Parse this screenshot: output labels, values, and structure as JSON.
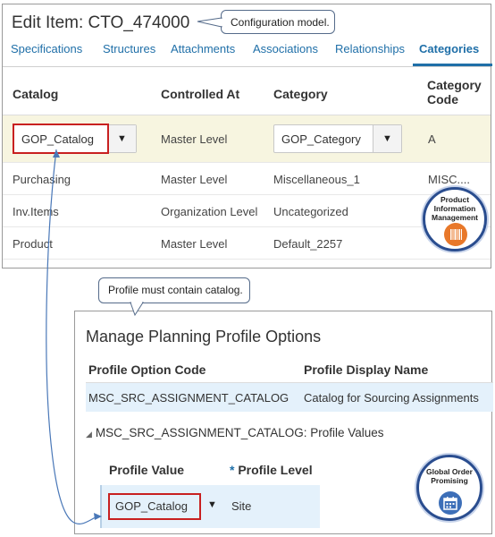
{
  "edit_item": {
    "title": "Edit Item: CTO_474000",
    "callout": "Configuration  model.",
    "tabs": [
      {
        "label": "Specifications"
      },
      {
        "label": "Structures"
      },
      {
        "label": "Attachments"
      },
      {
        "label": "Associations"
      },
      {
        "label": "Relationships"
      },
      {
        "label": "Categories",
        "active": true
      }
    ],
    "columns": {
      "catalog": "Catalog",
      "controlled_at": "Controlled At",
      "category": "Category",
      "category_code_line1": "Category",
      "category_code_line2": "Code"
    },
    "rows": [
      {
        "catalog": "GOP_Catalog",
        "controlled_at": "Master Level",
        "category": "GOP_Category",
        "code": "A"
      },
      {
        "catalog": "Purchasing",
        "controlled_at": "Master Level",
        "category": "Miscellaneous_1",
        "code": "MISC...."
      },
      {
        "catalog": "Inv.Items",
        "controlled_at": "Organization Level",
        "category": "Uncategorized",
        "code": ""
      },
      {
        "catalog": "Product",
        "controlled_at": "Master Level",
        "category": "Default_2257",
        "code": ""
      }
    ],
    "badge": {
      "line1": "Product",
      "line2": "Information",
      "line3": "Management",
      "icon": "barcode-icon",
      "icon_color": "#e8782a"
    }
  },
  "profile_callout": "Profile must contain catalog.",
  "planning_profile": {
    "title": "Manage Planning Profile Options",
    "columns": {
      "code": "Profile Option Code",
      "display": "Profile Display Name"
    },
    "row": {
      "code": "MSC_SRC_ASSIGNMENT_CATALOG",
      "display": "Catalog for Sourcing Assignments"
    },
    "values_heading": "MSC_SRC_ASSIGNMENT_CATALOG: Profile Values",
    "values_columns": {
      "value": "Profile Value",
      "required_mark": "*",
      "level": "Profile Level"
    },
    "values_row": {
      "value": "GOP_Catalog",
      "level": "Site"
    },
    "badge": {
      "line1": "Global Order",
      "line2": "Promising",
      "icon": "calendar-icon",
      "icon_color": "#3d6fb8"
    }
  },
  "colors": {
    "link": "#1f6fa8",
    "highlight_red": "#c82020",
    "selected_row": "#f7f5e0",
    "selected_blue": "#e4f1fb"
  }
}
